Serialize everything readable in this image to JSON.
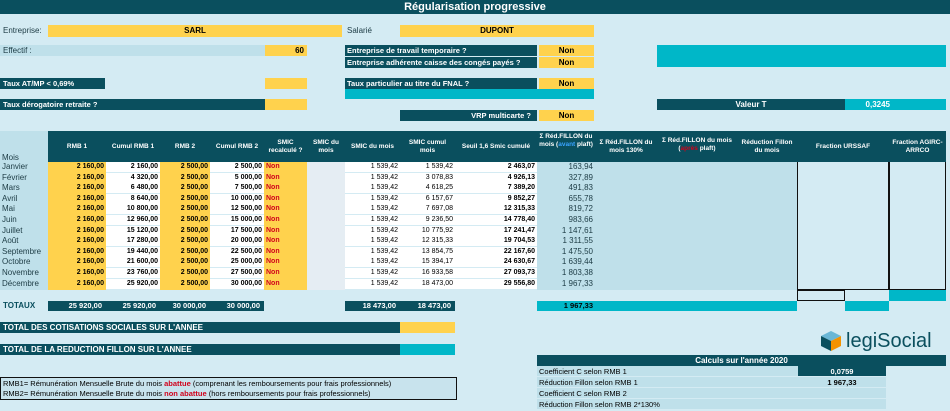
{
  "title": "Régularisation progressive",
  "top": {
    "entreprise_label": "Entreprise:",
    "entreprise_value": "SARL",
    "salarie_label": "Salarié",
    "salarie_value": "DUPONT",
    "effectif_label": "Effectif :",
    "effectif_value": "60",
    "q_temp_label": "Entreprise de travail temporaire ?",
    "q_temp_value": "Non",
    "q_conges_label": "Entreprise adhérente caisse des congés payés ?",
    "q_conges_value": "Non",
    "taux_atmp_label": "Taux AT/MP < 0,69%",
    "taux_fnal_label": "Taux particulier au titre du FNAL ?",
    "taux_fnal_value": "Non",
    "taux_derog_label": "Taux dérogatoire retraite ?",
    "valeur_t_label": "Valeur T",
    "valeur_t_value": "0,3245",
    "vrp_label": "VRP multicarte ?",
    "vrp_value": "Non"
  },
  "table": {
    "headers": {
      "mois": "Mois",
      "rmb1": "RMB 1",
      "cumul_rmb1": "Cumul RMB 1",
      "rmb2": "RMB 2",
      "cumul_rmb2": "Cumul RMB 2",
      "smic_recalcule": "SMIC recalculé ?",
      "smic_du_mois_1": "SMIC du mois",
      "smic_du_mois_2": "SMIC du mois",
      "smic_cumul": "SMIC cumul mois",
      "seuil": "Seuil 1,6 Smic cumulé",
      "red1_a": "Σ Réd.FILLON du mois (",
      "red1_b": "avant",
      "red1_c": " plaft)",
      "red2": "Σ Réd.FILLON du mois 130%",
      "red3_a": "Σ Réd.FILLON du mois (",
      "red3_b": "après",
      "red3_c": " plaft)",
      "reduction": "Réduction Fillon du mois",
      "fraction_urssaf": "Fraction URSSAF",
      "fraction_agirc": "Fraction AGIRC-ARRCO"
    },
    "rows": [
      {
        "mois": "Janvier",
        "rmb1": "2 160,00",
        "cumul_rmb1": "2 160,00",
        "rmb2": "2 500,00",
        "cumul_rmb2": "2 500,00",
        "smic_recalc": "Non",
        "smic_mois": "1 539,42",
        "smic_cumul": "1 539,42",
        "seuil": "2 463,07",
        "red": "163,94"
      },
      {
        "mois": "Février",
        "rmb1": "2 160,00",
        "cumul_rmb1": "4 320,00",
        "rmb2": "2 500,00",
        "cumul_rmb2": "5 000,00",
        "smic_recalc": "Non",
        "smic_mois": "1 539,42",
        "smic_cumul": "3 078,83",
        "seuil": "4 926,13",
        "red": "327,89"
      },
      {
        "mois": "Mars",
        "rmb1": "2 160,00",
        "cumul_rmb1": "6 480,00",
        "rmb2": "2 500,00",
        "cumul_rmb2": "7 500,00",
        "smic_recalc": "Non",
        "smic_mois": "1 539,42",
        "smic_cumul": "4 618,25",
        "seuil": "7 389,20",
        "red": "491,83"
      },
      {
        "mois": "Avril",
        "rmb1": "2 160,00",
        "cumul_rmb1": "8 640,00",
        "rmb2": "2 500,00",
        "cumul_rmb2": "10 000,00",
        "smic_recalc": "Non",
        "smic_mois": "1 539,42",
        "smic_cumul": "6 157,67",
        "seuil": "9 852,27",
        "red": "655,78"
      },
      {
        "mois": "Mai",
        "rmb1": "2 160,00",
        "cumul_rmb1": "10 800,00",
        "rmb2": "2 500,00",
        "cumul_rmb2": "12 500,00",
        "smic_recalc": "Non",
        "smic_mois": "1 539,42",
        "smic_cumul": "7 697,08",
        "seuil": "12 315,33",
        "red": "819,72"
      },
      {
        "mois": "Juin",
        "rmb1": "2 160,00",
        "cumul_rmb1": "12 960,00",
        "rmb2": "2 500,00",
        "cumul_rmb2": "15 000,00",
        "smic_recalc": "Non",
        "smic_mois": "1 539,42",
        "smic_cumul": "9 236,50",
        "seuil": "14 778,40",
        "red": "983,66"
      },
      {
        "mois": "Juillet",
        "rmb1": "2 160,00",
        "cumul_rmb1": "15 120,00",
        "rmb2": "2 500,00",
        "cumul_rmb2": "17 500,00",
        "smic_recalc": "Non",
        "smic_mois": "1 539,42",
        "smic_cumul": "10 775,92",
        "seuil": "17 241,47",
        "red": "1 147,61"
      },
      {
        "mois": "Août",
        "rmb1": "2 160,00",
        "cumul_rmb1": "17 280,00",
        "rmb2": "2 500,00",
        "cumul_rmb2": "20 000,00",
        "smic_recalc": "Non",
        "smic_mois": "1 539,42",
        "smic_cumul": "12 315,33",
        "seuil": "19 704,53",
        "red": "1 311,55"
      },
      {
        "mois": "Septembre",
        "rmb1": "2 160,00",
        "cumul_rmb1": "19 440,00",
        "rmb2": "2 500,00",
        "cumul_rmb2": "22 500,00",
        "smic_recalc": "Non",
        "smic_mois": "1 539,42",
        "smic_cumul": "13 854,75",
        "seuil": "22 167,60",
        "red": "1 475,50"
      },
      {
        "mois": "Octobre",
        "rmb1": "2 160,00",
        "cumul_rmb1": "21 600,00",
        "rmb2": "2 500,00",
        "cumul_rmb2": "25 000,00",
        "smic_recalc": "Non",
        "smic_mois": "1 539,42",
        "smic_cumul": "15 394,17",
        "seuil": "24 630,67",
        "red": "1 639,44"
      },
      {
        "mois": "Novembre",
        "rmb1": "2 160,00",
        "cumul_rmb1": "23 760,00",
        "rmb2": "2 500,00",
        "cumul_rmb2": "27 500,00",
        "smic_recalc": "Non",
        "smic_mois": "1 539,42",
        "smic_cumul": "16 933,58",
        "seuil": "27 093,73",
        "red": "1 803,38"
      },
      {
        "mois": "Décembre",
        "rmb1": "2 160,00",
        "cumul_rmb1": "25 920,00",
        "rmb2": "2 500,00",
        "cumul_rmb2": "30 000,00",
        "smic_recalc": "Non",
        "smic_mois": "1 539,42",
        "smic_cumul": "18 473,00",
        "seuil": "29 556,80",
        "red": "1 967,33"
      }
    ],
    "totaux": {
      "label": "TOTAUX",
      "rmb1": "25 920,00",
      "cumul_rmb1": "25 920,00",
      "rmb2": "30 000,00",
      "cumul_rmb2": "30 000,00",
      "smic_mois": "18 473,00",
      "smic_cumul": "18 473,00",
      "red": "1 967,33"
    }
  },
  "bottom": {
    "total_cotis_label": "TOTAL DES COTISATIONS SOCIALES SUR L'ANNEE",
    "total_red_label": "TOTAL DE LA REDUCTION FILLON SUR L'ANNEE",
    "logo_text": "legiSocial",
    "calc_title": "Calculs sur l'année 2020",
    "calc_rows": [
      {
        "label": "Coefficient C selon RMB 1",
        "value": "0,0759"
      },
      {
        "label": "Réduction Fillon selon RMB 1",
        "value": "1 967,33"
      },
      {
        "label": "Coefficient C selon RMB 2",
        "value": ""
      },
      {
        "label": "Réduction Fillon selon RMB 2*130%",
        "value": ""
      }
    ],
    "note1_a": "RMB1= Rémunération Mensuelle Brute du mois ",
    "note1_b": "abattue",
    "note1_c": " (comprenant les remboursements pour frais professionnels)",
    "note2_a": "RMB2= Rémunération Mensuelle Brute du mois ",
    "note2_b": "non abattue",
    "note2_c": " (hors remboursements pour frais professionnels)"
  },
  "colors": {
    "teal": "#0a4f5e",
    "cyan": "#00b7c8",
    "yellow": "#ffd24d",
    "light": "#bfe0ea",
    "bg": "#d4ebf3",
    "red": "#d0021b"
  }
}
